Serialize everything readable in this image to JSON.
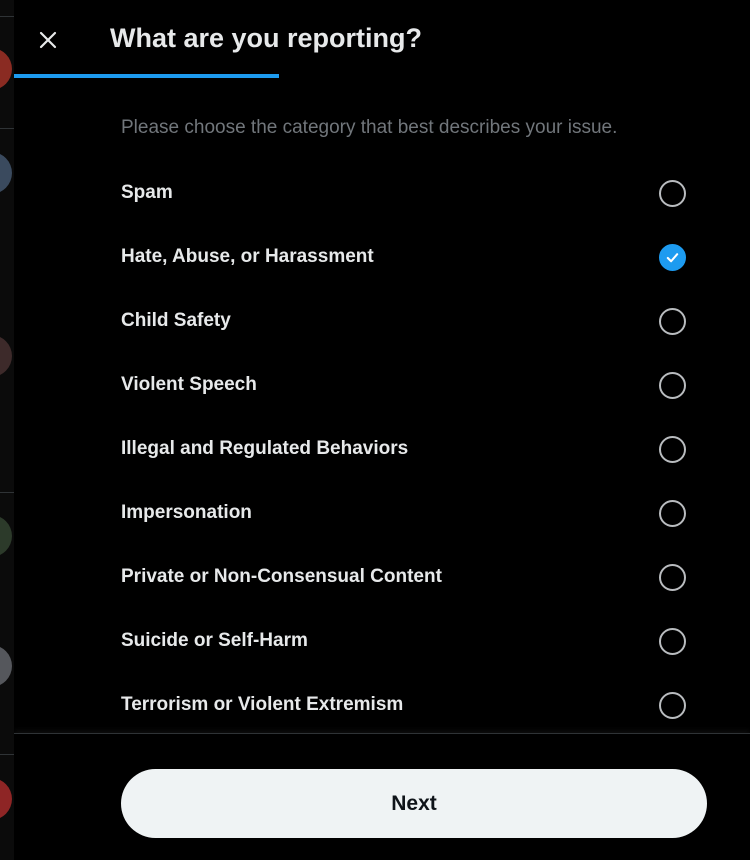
{
  "dialog": {
    "title": "What are you reporting?",
    "subtitle": "Please choose the category that best describes your issue.",
    "progress_fraction": 0.36,
    "close_icon": "close-icon"
  },
  "options": [
    {
      "label": "Spam",
      "selected": false
    },
    {
      "label": "Hate, Abuse, or Harassment",
      "selected": true
    },
    {
      "label": "Child Safety",
      "selected": false
    },
    {
      "label": "Violent Speech",
      "selected": false
    },
    {
      "label": "Illegal and Regulated Behaviors",
      "selected": false
    },
    {
      "label": "Impersonation",
      "selected": false
    },
    {
      "label": "Private or Non-Consensual Content",
      "selected": false
    },
    {
      "label": "Suicide or Self-Harm",
      "selected": false
    },
    {
      "label": "Terrorism or Violent Extremism",
      "selected": false
    }
  ],
  "footer": {
    "next_label": "Next"
  },
  "colors": {
    "accent": "#1d9bf0",
    "background": "#000000",
    "text": "#e7e9ea",
    "muted_text": "#71767b",
    "button_bg": "#eff3f4"
  }
}
